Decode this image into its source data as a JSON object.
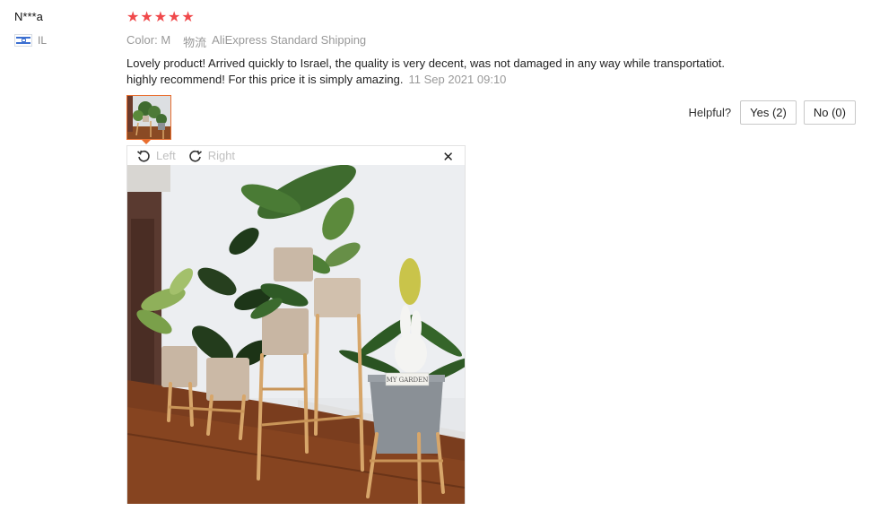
{
  "reviewer": {
    "name": "N***a",
    "country": "IL"
  },
  "rating": {
    "stars": 5,
    "max": 5,
    "star_color": "#f0494b"
  },
  "meta": {
    "color_label": "Color:",
    "color_value": "M",
    "logistics_label": "物流",
    "shipping": "AliExpress Standard Shipping"
  },
  "review": {
    "line1": "Lovely product! Arrived quickly to Israel, the quality is very decent, was not damaged in any way while transportatiot.",
    "line2": "highly recommend! For this price it is simply amazing.",
    "date": "11 Sep 2021 09:10"
  },
  "helpful": {
    "label": "Helpful?",
    "yes": "Yes (2)",
    "no": "No (0)"
  },
  "viewer": {
    "rotate_left": "Left",
    "rotate_right": "Right",
    "close_icon": "close-icon",
    "sign_text": "MY GARDEN"
  },
  "colors": {
    "accent": "#e96e2f",
    "muted": "#999999"
  }
}
